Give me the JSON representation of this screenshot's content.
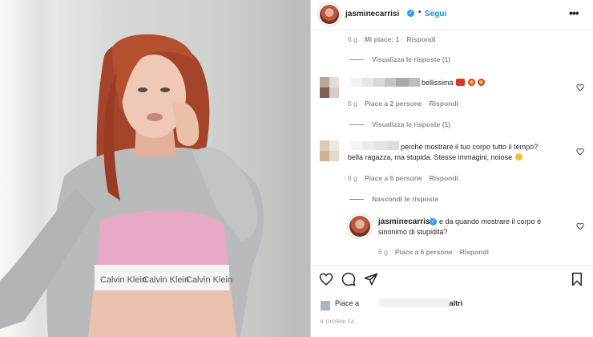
{
  "header": {
    "username": "jasminecarrisi",
    "verified_mark": "✓",
    "separator": "•",
    "follow_label": "Segui",
    "more_icon": "more-horizontal-icon"
  },
  "comments": [
    {
      "id": "top",
      "meta": {
        "time": "6 g",
        "likes": "Mi piace: 1",
        "reply": "Rispondi"
      },
      "view_replies": "Visualizza le risposte (1)"
    },
    {
      "id": "c1",
      "text": "bellissima",
      "meta": {
        "time": "6 g",
        "likes": "Piace a 2 persone",
        "reply": "Rispondi"
      },
      "view_replies": "Visualizza le risposte (1)"
    },
    {
      "id": "c2",
      "text_line1": "perché mostrare il tuo corpo tutto il tempo?",
      "text_line2": "bella ragazza, ma stupida. Stesse immagini, noiose",
      "meta": {
        "time": "6 g",
        "likes": "Piace a 6 persone",
        "reply": "Rispondi"
      },
      "hide_replies": "Nascondi le risposte"
    },
    {
      "id": "reply",
      "username": "jasminecarrisi",
      "text_line1": "e da quando mostrare il corpo è",
      "text_line2": "sinonimo di stupidità?",
      "meta": {
        "time": "6 g",
        "likes": "Piace a 6 persone",
        "reply": "Rispondi"
      }
    }
  ],
  "footer": {
    "likes_prefix": "Piace a",
    "likes_suffix": "e altri",
    "timestamp": "6 GIORNI FA"
  },
  "photo": {
    "bra_brand": "Calvin Klein"
  },
  "colors": {
    "link": "#0095f6",
    "verified": "#3897f0",
    "muted": "#8e8e8e",
    "text": "#262626"
  }
}
